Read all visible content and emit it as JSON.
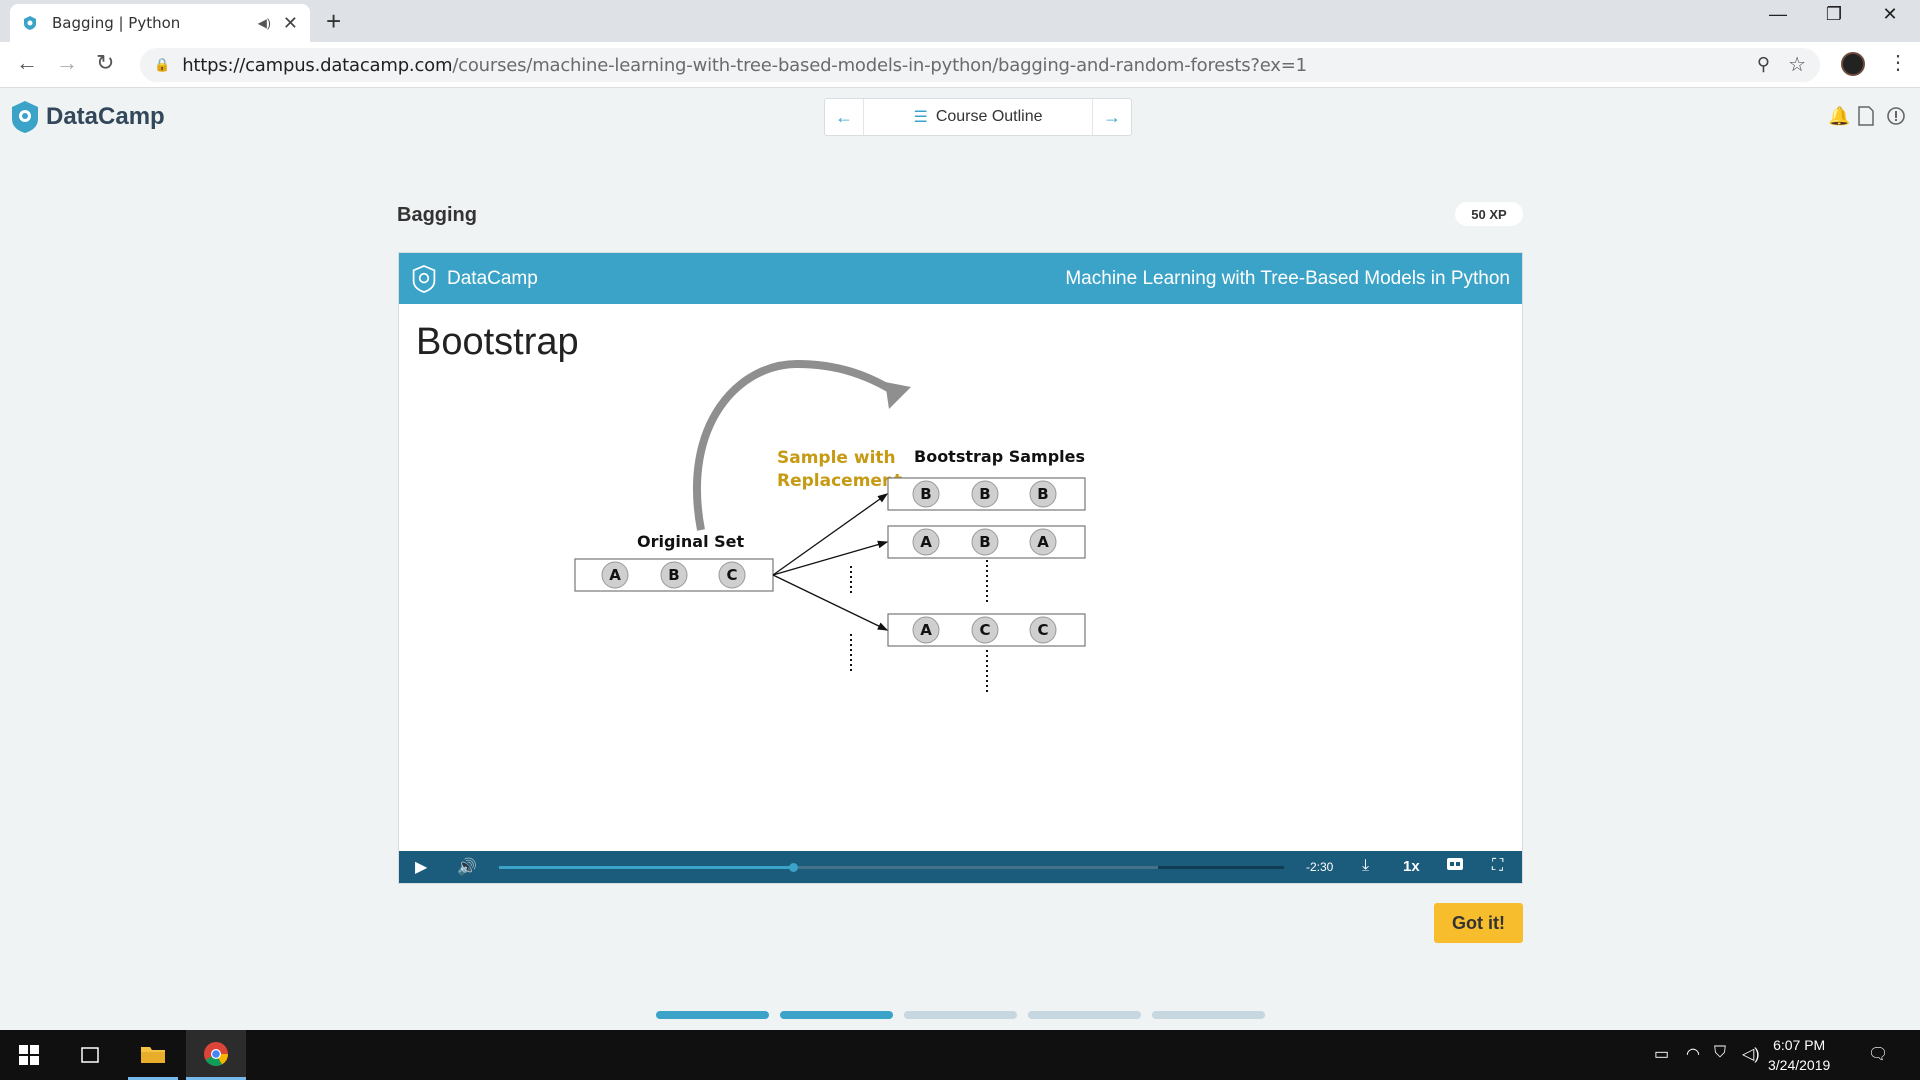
{
  "browser": {
    "tab_title": "Bagging | Python",
    "url_host": "https://campus.datacamp.com",
    "url_path": "/courses/machine-learning-with-tree-based-models-in-python/bagging-and-random-forests?ex=1",
    "new_tab_glyph": "+",
    "icons": [
      "back-icon",
      "forward-icon",
      "reload-icon",
      "lock-icon",
      "zoom-icon",
      "star-icon",
      "avatar",
      "menu-icon",
      "minimize-icon",
      "maximize-icon",
      "close-icon"
    ]
  },
  "header": {
    "brand": "DataCamp",
    "outline_label": "Course Outline",
    "icons": [
      "bell-icon",
      "pdf-icon",
      "info-icon"
    ]
  },
  "exercise": {
    "title": "Bagging",
    "xp": "50 XP",
    "got_it": "Got it!"
  },
  "slide": {
    "brand": "DataCamp",
    "course": "Machine Learning with Tree-Based Models in Python",
    "title": "Bootstrap",
    "diagram": {
      "sample_label_1": "Sample with",
      "sample_label_2": "Replacement",
      "bootstrap_label": "Bootstrap Samples",
      "original_label": "Original Set",
      "original": [
        "A",
        "B",
        "C"
      ],
      "samples": [
        [
          "B",
          "B",
          "B"
        ],
        [
          "A",
          "B",
          "A"
        ],
        [
          "A",
          "C",
          "C"
        ]
      ]
    }
  },
  "player": {
    "time_left": "-2:30",
    "speed": "1x",
    "played_fraction": 0.375,
    "buffered_fraction": 0.84
  },
  "progress_dots": {
    "total": 5,
    "done": 2
  },
  "colors": {
    "accent": "#3ba3c8",
    "player": "#1b5c7c",
    "cta": "#f7bd2c",
    "annotation": "#c79a14"
  },
  "taskbar": {
    "time": "6:07 PM",
    "date": "3/24/2019"
  }
}
